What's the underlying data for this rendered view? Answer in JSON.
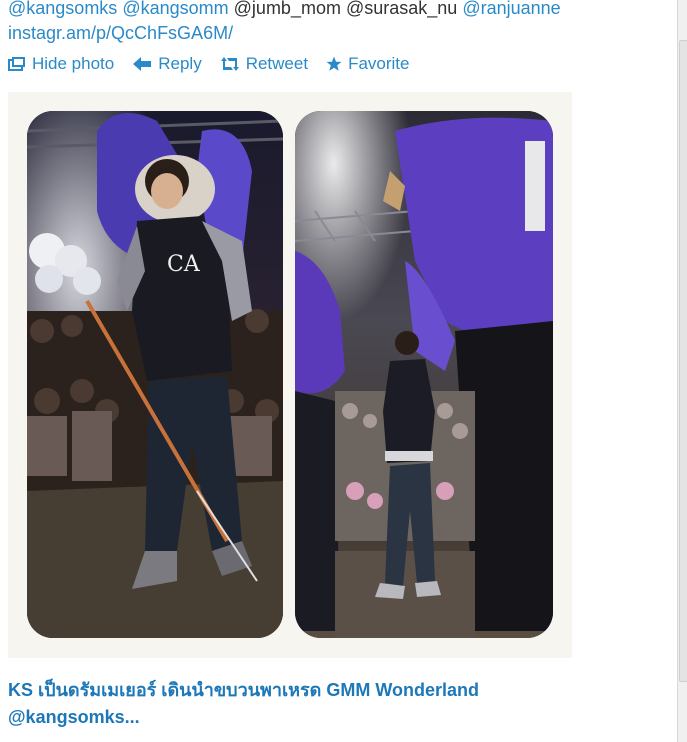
{
  "tweet": {
    "mentions": [
      "@kangsomks",
      "@kangsomm",
      "@jumb_mom",
      "@surasak_nu",
      "@ranjuanne"
    ],
    "link": "instagr.am/p/QcChFsGA6M/",
    "actions": {
      "hide_photo": "Hide photo",
      "reply": "Reply",
      "retweet": "Retweet",
      "favorite": "Favorite"
    },
    "caption_line1": "KS เป็นดรัมเมเยอร์ เดินนำขบวนพาเหรด GMM Wonderland",
    "caption_line2": "@kangsomks..."
  },
  "colors": {
    "link": "#2a8ac9",
    "caption": "#1d78b8",
    "plain_text": "#333333"
  }
}
